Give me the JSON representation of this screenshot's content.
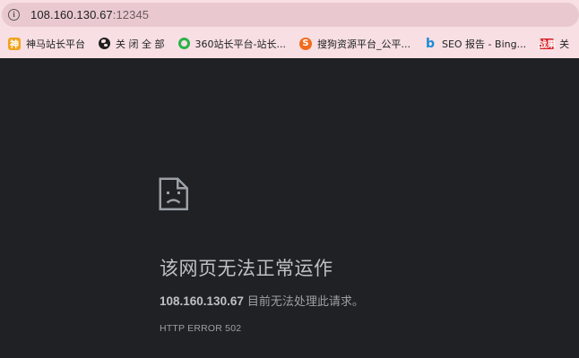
{
  "browser": {
    "url_host": "108.160.130.67",
    "url_port": ":12345",
    "bookmarks": [
      {
        "label": "神马站长平台",
        "icon": "shenma-favicon",
        "glyph": "神"
      },
      {
        "label": "关 闭 全 部",
        "icon": "globe-icon",
        "glyph": ""
      },
      {
        "label": "360站长平台-站长...",
        "icon": "360-favicon",
        "glyph": ""
      },
      {
        "label": "搜狗资源平台_公平...",
        "icon": "sogou-favicon",
        "glyph": "S"
      },
      {
        "label": "SEO 报告 - Bing...",
        "icon": "bing-favicon",
        "glyph": "b"
      },
      {
        "label": "关",
        "icon": "red-favicon",
        "glyph": "战果"
      }
    ]
  },
  "error_page": {
    "icon": "sad-page-icon",
    "title": "该网页无法正常运作",
    "host": "108.160.130.67",
    "message": "目前无法处理此请求。",
    "code": "HTTP ERROR 502"
  },
  "colors": {
    "chrome_bg": "#f7dfe3",
    "address_bg": "#e9c9cf",
    "page_bg": "#202124",
    "title_text": "#bdc1c6",
    "body_text": "#9aa0a6"
  }
}
